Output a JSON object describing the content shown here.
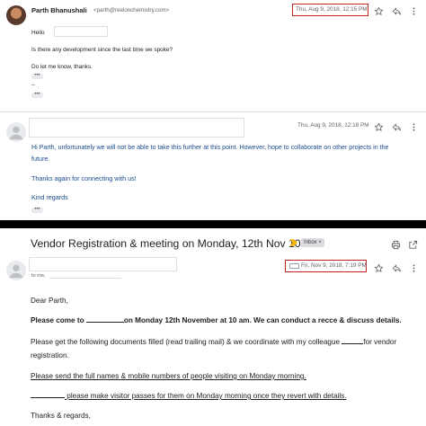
{
  "thread": {
    "message1": {
      "sender_name": "Parth Bhanushali",
      "sender_email": "<parth@reelonchemistry.com>",
      "date": "Thu, Aug 9, 2018, 12:15 PM",
      "lines": [
        "Hello",
        "Is there any development since the last time we spoke?",
        "Do let me know, thanks.",
        "--"
      ]
    },
    "message2": {
      "date": "Thu, Aug 9, 2018, 12:18 PM",
      "lines": [
        "Hi Parth, unfortunately we will not be able to take this further at this point. However, hope to collaborate on other projects in the",
        "future.",
        "Thanks again for connecting with us!",
        "Kind regards"
      ]
    },
    "ellipsis": "•••"
  },
  "email": {
    "subject": "Vendor Registration & meeting on Monday, 12th Nov 10am",
    "label_chip": "Inbox ×",
    "to_prefix": "to me,",
    "date": "Fri, Nov 9, 2018, 7:19 PM",
    "greeting": "Dear Parth,",
    "line1_a": "Please come to",
    "line1_b": "on Monday 12th November at 10 am. We can conduct a recce & discuss details.",
    "line2_a": "Please get the following documents filled (read trailing mail) & we coordinate with my colleague",
    "line2_b": "for vendor",
    "line3": "registration.",
    "line4": "Please send the full names & mobile numbers of people visiting on Monday morning.",
    "line5": "please make visitor passes for them on Monday morning once they revert with details.",
    "closing": "Thanks & regards,"
  },
  "colors": {
    "highlight_box": "#c5221f",
    "reply_blue": "#1a4a8a",
    "separator": "#000000",
    "importance_marker": "#f4b400"
  },
  "icons": [
    "star-icon",
    "reply-icon",
    "more-vert-icon",
    "print-icon",
    "open-new-window-icon",
    "person-icon",
    "importance-marker-icon",
    "label-icon"
  ]
}
